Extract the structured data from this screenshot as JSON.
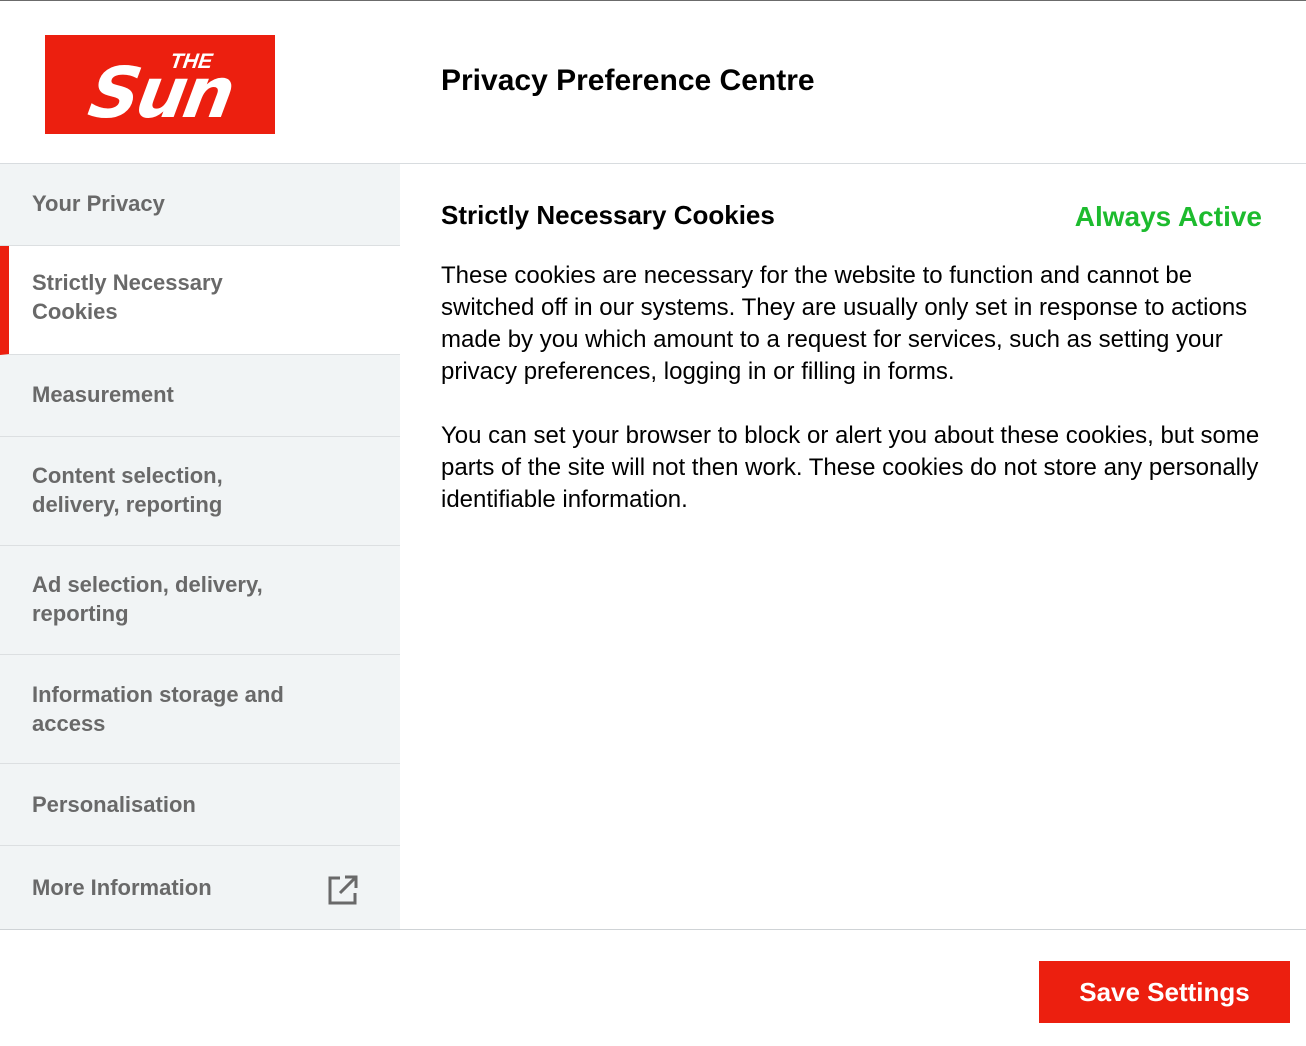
{
  "brand": {
    "logo_small": "THE",
    "logo_big": "Sun",
    "color": "#ec1f0f"
  },
  "header": {
    "title": "Privacy Preference Centre"
  },
  "sidebar": {
    "items": [
      {
        "label": "Your Privacy"
      },
      {
        "label": "Strictly Necessary Cookies",
        "active": true
      },
      {
        "label": "Measurement"
      },
      {
        "label": "Content selection, delivery, reporting"
      },
      {
        "label": "Ad selection, delivery, reporting"
      },
      {
        "label": "Information storage and access"
      },
      {
        "label": "Personalisation"
      },
      {
        "label": "More Information",
        "icon": "external-link-icon"
      }
    ]
  },
  "content": {
    "heading": "Strictly Necessary Cookies",
    "status": "Always Active",
    "status_color": "#1dbb2e",
    "paragraphs": [
      "These cookies are necessary for the website to function and cannot be switched off in our systems. They are usually only set in response to actions made by you which amount to a request for services, such as setting your privacy preferences, logging in or filling in forms.",
      "You can set your browser to block or alert you about these cookies, but some parts of the site will not then work. These cookies do not store any personally identifiable information."
    ]
  },
  "footer": {
    "save_label": "Save Settings"
  }
}
